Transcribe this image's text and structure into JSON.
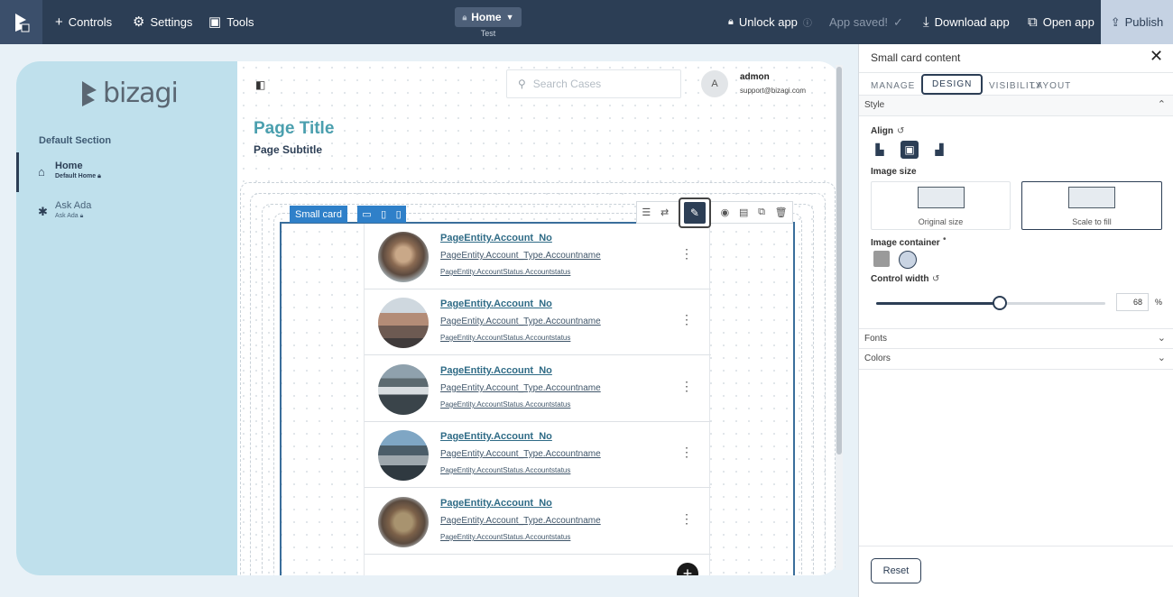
{
  "topbar": {
    "controls": "Controls",
    "settings": "Settings",
    "tools": "Tools",
    "page_selector": "Home",
    "page_selector_sub": "Test",
    "unlock": "Unlock app",
    "saved": "App saved!",
    "download": "Download app",
    "open": "Open app",
    "publish": "Publish"
  },
  "sidebar": {
    "brand": "bizagi",
    "section": "Default Section",
    "items": [
      {
        "label": "Home",
        "sub": "Default Home"
      },
      {
        "label": "Ask Ada",
        "sub": "Ask Ada"
      }
    ]
  },
  "header": {
    "search_placeholder": "Search Cases",
    "avatar_initial": "A",
    "user_name": "admon",
    "user_email": "support@bizagi.com"
  },
  "page": {
    "title": "Page Title",
    "subtitle": "Page Subtitle"
  },
  "card": {
    "label": "Small card"
  },
  "rows": [
    {
      "l1": "PageEntity.Account_No",
      "l2": "PageEntity.Account_Type.Accountname",
      "l3": "PageEntity.AccountStatus.Accountstatus"
    },
    {
      "l1": "PageEntity.Account_No",
      "l2": "PageEntity.Account_Type.Accountname",
      "l3": "PageEntity.AccountStatus.Accountstatus"
    },
    {
      "l1": "PageEntity.Account_No",
      "l2": "PageEntity.Account_Type.Accountname",
      "l3": "PageEntity.AccountStatus.Accountstatus"
    },
    {
      "l1": "PageEntity.Account_No",
      "l2": "PageEntity.Account_Type.Accountname",
      "l3": "PageEntity.AccountStatus.Accountstatus"
    },
    {
      "l1": "PageEntity.Account_No",
      "l2": "PageEntity.Account_Type.Accountname",
      "l3": "PageEntity.AccountStatus.Accountstatus"
    }
  ],
  "panel": {
    "title": "Small card content",
    "tabs": [
      "MANAGE",
      "DESIGN",
      "VISIBILITY",
      "LAYOUT"
    ],
    "active_tab": "DESIGN",
    "style_section": "Style",
    "align_label": "Align",
    "image_size_label": "Image size",
    "image_size_options": [
      "Original size",
      "Scale to fill"
    ],
    "image_container_label": "Image container",
    "control_width_label": "Control width",
    "control_width_value": "68",
    "control_width_unit": "%",
    "control_width_fraction": 0.68,
    "fonts_section": "Fonts",
    "colors_section": "Colors",
    "reset": "Reset"
  },
  "colors": {
    "topbar": "#2c3e55",
    "accent_blue": "#2f80c9",
    "title_teal": "#4a9fae",
    "sidebar_bg": "#bfe0ec"
  }
}
